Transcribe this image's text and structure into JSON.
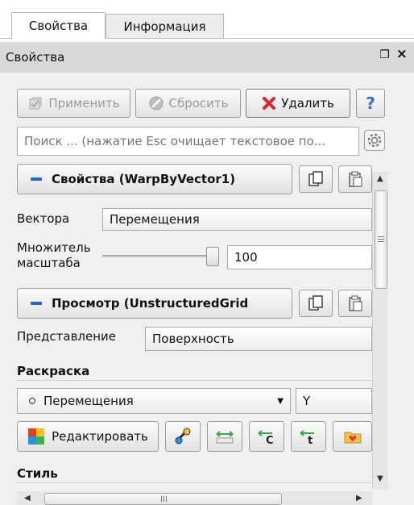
{
  "tabs": [
    {
      "label": "Свойства",
      "active": true
    },
    {
      "label": "Информация",
      "active": false
    }
  ],
  "dock": {
    "title": "Свойства",
    "float_glyph": "❐",
    "close_glyph": "×"
  },
  "toolbar": {
    "apply_label": "Применить",
    "reset_label": "Сбросить",
    "delete_label": "Удалить",
    "help_label": "?"
  },
  "search": {
    "placeholder": "Поиск ... (нажатие Esc очищает текстовое по..."
  },
  "properties_section": {
    "title": "Свойства (WarpByVector1)"
  },
  "vectors": {
    "label": "Вектора",
    "value": "Перемещения"
  },
  "scale_factor": {
    "label_line1": "Множитель",
    "label_line2": "масштаба",
    "value": "100"
  },
  "view_section": {
    "title": "Просмотр (UnstructuredGrid"
  },
  "representation": {
    "label": "Представление",
    "value": "Поверхность"
  },
  "coloring": {
    "header": "Раскраска",
    "array_value": "Перемещения",
    "component_value": "Y",
    "edit_label": "Редактировать"
  },
  "style": {
    "header": "Стиль"
  },
  "colors": {
    "dock_header_bg": "#d9d9d9",
    "panel_bg": "#f0f0f0",
    "accent_blue": "#2a63c6",
    "delete_red": "#d8262c",
    "help_blue": "#2f6fd2"
  }
}
